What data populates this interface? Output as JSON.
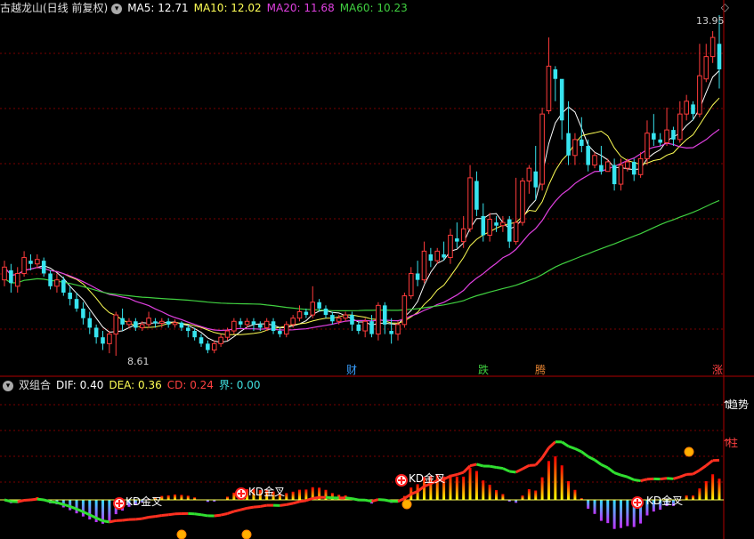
{
  "main_header": {
    "title": "古越龙山(日线 前复权)",
    "ma5": "MA5: 12.71",
    "ma10": "MA10: 12.02",
    "ma20": "MA20: 11.68",
    "ma60": "MA60: 10.23"
  },
  "sub_header": {
    "title": "双组合",
    "dif": "DIF: 0.40",
    "dea": "DEA: 0.36",
    "cd": "CD: 0.24",
    "jie": "界: 0.00"
  },
  "colors": {
    "up": "#ff3b3b",
    "down": "#37e4ef",
    "ma5": "#ffffff",
    "ma10": "#ffff55",
    "ma20": "#e040e0",
    "ma60": "#40d040",
    "grid": "#7a0000"
  },
  "annotations": {
    "high": "13.95",
    "low": "8.61",
    "kd1": "KD金叉",
    "kd2": "KD金叉",
    "kd3": "KD金叉",
    "kd4": "KD金叉",
    "trend": "趋势",
    "zhu": "柱"
  },
  "event_markers": [
    {
      "label": "财",
      "color": "#3aa0ff"
    },
    {
      "label": "跌",
      "color": "#40d040"
    },
    {
      "label": "腾",
      "color": "#e08030"
    },
    {
      "label": "涨",
      "color": "#ff4040"
    }
  ],
  "chart_data": [
    {
      "type": "candlestick",
      "title": "古越龙山(日线 前复权)",
      "high_label": 13.95,
      "low_label": 8.61,
      "series": [
        {
          "name": "MA5",
          "value": 12.71
        },
        {
          "name": "MA10",
          "value": 12.02
        },
        {
          "name": "MA20",
          "value": 11.68
        },
        {
          "name": "MA60",
          "value": 10.23
        }
      ],
      "candles": [
        [
          9.8,
          10.0,
          9.7,
          10.1
        ],
        [
          9.95,
          9.75,
          9.6,
          10.05
        ],
        [
          9.7,
          9.9,
          9.6,
          10.0
        ],
        [
          9.9,
          10.15,
          9.85,
          10.25
        ],
        [
          10.1,
          10.05,
          9.95,
          10.2
        ],
        [
          10.05,
          10.12,
          9.98,
          10.2
        ],
        [
          10.1,
          9.9,
          9.85,
          10.15
        ],
        [
          9.9,
          9.7,
          9.65,
          9.95
        ],
        [
          9.7,
          9.8,
          9.6,
          9.9
        ],
        [
          9.8,
          9.6,
          9.55,
          9.85
        ],
        [
          9.6,
          9.5,
          9.4,
          9.7
        ],
        [
          9.5,
          9.35,
          9.3,
          9.6
        ],
        [
          9.35,
          9.2,
          9.1,
          9.45
        ],
        [
          9.2,
          9.05,
          8.95,
          9.3
        ],
        [
          9.05,
          8.9,
          8.8,
          9.1
        ],
        [
          8.9,
          8.8,
          8.7,
          9.0
        ],
        [
          8.8,
          8.95,
          8.65,
          9.0
        ],
        [
          8.95,
          9.25,
          8.61,
          9.3
        ],
        [
          9.2,
          9.1,
          9.0,
          9.35
        ],
        [
          9.1,
          9.15,
          9.05,
          9.2
        ],
        [
          9.15,
          9.05,
          9.0,
          9.2
        ],
        [
          9.05,
          9.1,
          9.0,
          9.15
        ],
        [
          9.1,
          9.2,
          9.05,
          9.3
        ],
        [
          9.15,
          9.12,
          9.05,
          9.2
        ],
        [
          9.12,
          9.15,
          9.05,
          9.2
        ],
        [
          9.15,
          9.1,
          9.05,
          9.2
        ],
        [
          9.1,
          9.13,
          9.05,
          9.18
        ],
        [
          9.13,
          9.05,
          9.0,
          9.15
        ],
        [
          9.05,
          9.0,
          8.9,
          9.1
        ],
        [
          9.0,
          8.9,
          8.85,
          9.05
        ],
        [
          8.9,
          8.8,
          8.75,
          8.95
        ],
        [
          8.8,
          8.7,
          8.65,
          8.85
        ],
        [
          8.7,
          8.8,
          8.65,
          8.85
        ],
        [
          8.8,
          8.9,
          8.75,
          8.95
        ],
        [
          8.9,
          9.0,
          8.85,
          9.05
        ],
        [
          9.0,
          9.15,
          8.95,
          9.2
        ],
        [
          9.15,
          9.1,
          9.05,
          9.2
        ],
        [
          9.1,
          9.15,
          9.05,
          9.2
        ],
        [
          9.15,
          9.1,
          9.0,
          9.2
        ],
        [
          9.1,
          9.05,
          9.0,
          9.15
        ],
        [
          9.05,
          9.15,
          9.0,
          9.2
        ],
        [
          9.15,
          9.0,
          8.95,
          9.2
        ],
        [
          9.0,
          8.95,
          8.9,
          9.05
        ],
        [
          8.95,
          9.1,
          8.9,
          9.15
        ],
        [
          9.1,
          9.2,
          9.05,
          9.25
        ],
        [
          9.2,
          9.3,
          9.15,
          9.4
        ],
        [
          9.3,
          9.25,
          9.2,
          9.35
        ],
        [
          9.25,
          9.45,
          9.2,
          9.7
        ],
        [
          9.45,
          9.35,
          9.3,
          9.5
        ],
        [
          9.35,
          9.25,
          9.2,
          9.4
        ],
        [
          9.25,
          9.15,
          9.1,
          9.3
        ],
        [
          9.15,
          9.2,
          9.1,
          9.25
        ],
        [
          9.2,
          9.25,
          9.15,
          9.3
        ],
        [
          9.25,
          9.1,
          9.0,
          9.3
        ],
        [
          9.1,
          9.0,
          8.95,
          9.15
        ],
        [
          9.0,
          9.15,
          8.9,
          9.2
        ],
        [
          9.15,
          8.95,
          8.9,
          9.25
        ],
        [
          8.95,
          9.4,
          8.85,
          9.45
        ],
        [
          9.4,
          9.1,
          8.95,
          9.45
        ],
        [
          9.0,
          8.95,
          8.8,
          9.2
        ],
        [
          8.95,
          9.1,
          8.85,
          9.15
        ],
        [
          9.1,
          9.55,
          9.05,
          9.6
        ],
        [
          9.55,
          9.9,
          9.5,
          10.0
        ],
        [
          9.9,
          9.8,
          9.7,
          10.1
        ],
        [
          9.8,
          10.25,
          9.75,
          10.4
        ],
        [
          10.2,
          10.1,
          10.0,
          10.3
        ],
        [
          10.1,
          10.25,
          10.05,
          10.3
        ],
        [
          10.2,
          10.15,
          10.1,
          10.4
        ],
        [
          10.15,
          10.5,
          10.05,
          10.6
        ],
        [
          10.45,
          10.4,
          10.3,
          10.7
        ],
        [
          10.4,
          10.6,
          10.3,
          10.8
        ],
        [
          10.6,
          11.4,
          10.55,
          11.6
        ],
        [
          11.35,
          10.9,
          10.8,
          11.5
        ],
        [
          10.8,
          10.5,
          10.4,
          11.0
        ],
        [
          10.5,
          10.75,
          10.4,
          10.85
        ],
        [
          10.7,
          10.65,
          10.55,
          10.8
        ],
        [
          10.65,
          10.7,
          10.55,
          10.8
        ],
        [
          10.75,
          10.4,
          10.3,
          10.8
        ],
        [
          10.4,
          10.7,
          10.35,
          11.4
        ],
        [
          10.7,
          11.35,
          10.65,
          11.4
        ],
        [
          11.35,
          11.55,
          11.15,
          11.6
        ],
        [
          11.5,
          11.25,
          11.05,
          11.9
        ],
        [
          11.3,
          12.4,
          11.2,
          12.5
        ],
        [
          12.45,
          13.15,
          12.4,
          13.6
        ],
        [
          13.1,
          12.95,
          12.6,
          13.15
        ],
        [
          12.95,
          12.3,
          12.0,
          12.8
        ],
        [
          12.1,
          11.75,
          11.6,
          12.6
        ],
        [
          11.75,
          12.0,
          11.6,
          12.1
        ],
        [
          12.0,
          11.9,
          11.8,
          12.35
        ],
        [
          11.9,
          11.6,
          11.5,
          12.0
        ],
        [
          11.6,
          11.75,
          11.55,
          11.8
        ],
        [
          11.6,
          11.5,
          11.45,
          11.9
        ],
        [
          11.5,
          11.65,
          11.5,
          11.7
        ],
        [
          11.6,
          11.3,
          11.2,
          11.7
        ],
        [
          11.3,
          11.6,
          11.2,
          11.7
        ],
        [
          11.55,
          11.65,
          11.5,
          11.7
        ],
        [
          11.65,
          11.45,
          11.35,
          11.7
        ],
        [
          11.45,
          11.7,
          11.4,
          11.8
        ],
        [
          11.7,
          12.1,
          11.6,
          12.3
        ],
        [
          12.1,
          12.0,
          11.9,
          12.4
        ],
        [
          12.0,
          11.95,
          11.9,
          12.1
        ],
        [
          11.95,
          12.15,
          11.9,
          12.5
        ],
        [
          12.15,
          12.0,
          11.9,
          12.2
        ],
        [
          12.0,
          12.4,
          11.95,
          12.6
        ],
        [
          12.4,
          12.6,
          12.3,
          12.7
        ],
        [
          12.55,
          12.4,
          12.3,
          12.6
        ],
        [
          12.4,
          13.0,
          12.35,
          13.5
        ],
        [
          12.95,
          13.3,
          12.9,
          13.5
        ],
        [
          13.3,
          13.6,
          13.2,
          13.7
        ],
        [
          13.5,
          13.1,
          12.8,
          13.95
        ]
      ]
    },
    {
      "type": "bar",
      "title": "双组合",
      "series": [
        {
          "name": "DIF",
          "value": 0.4
        },
        {
          "name": "DEA",
          "value": 0.36
        },
        {
          "name": "CD",
          "value": 0.24
        },
        {
          "name": "界",
          "value": 0.0
        }
      ],
      "signals": [
        "KD金叉",
        "KD金叉",
        "KD金叉",
        "KD金叉",
        "趋势",
        "柱"
      ]
    }
  ]
}
